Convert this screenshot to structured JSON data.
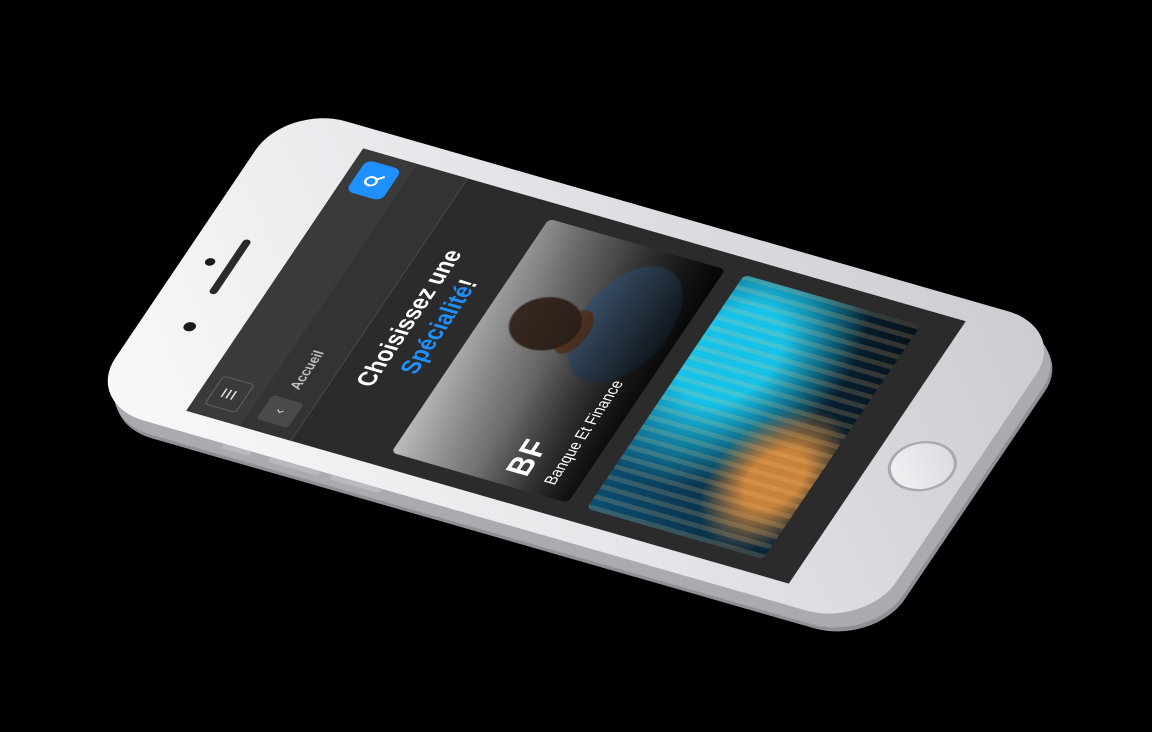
{
  "header": {
    "menu_icon": "hamburger-icon",
    "search_icon": "search-icon",
    "accent_color": "#1e90ff"
  },
  "breadcrumb": {
    "back_icon": "chevron-left-icon",
    "back_glyph": "‹",
    "label": "Accueil"
  },
  "heading": {
    "line1": "Choisissez une",
    "accent": "Spécialité",
    "suffix": "!"
  },
  "cards": [
    {
      "abbr": "BF",
      "title": "Banque Et Finance"
    },
    {
      "abbr": "",
      "title": ""
    }
  ]
}
